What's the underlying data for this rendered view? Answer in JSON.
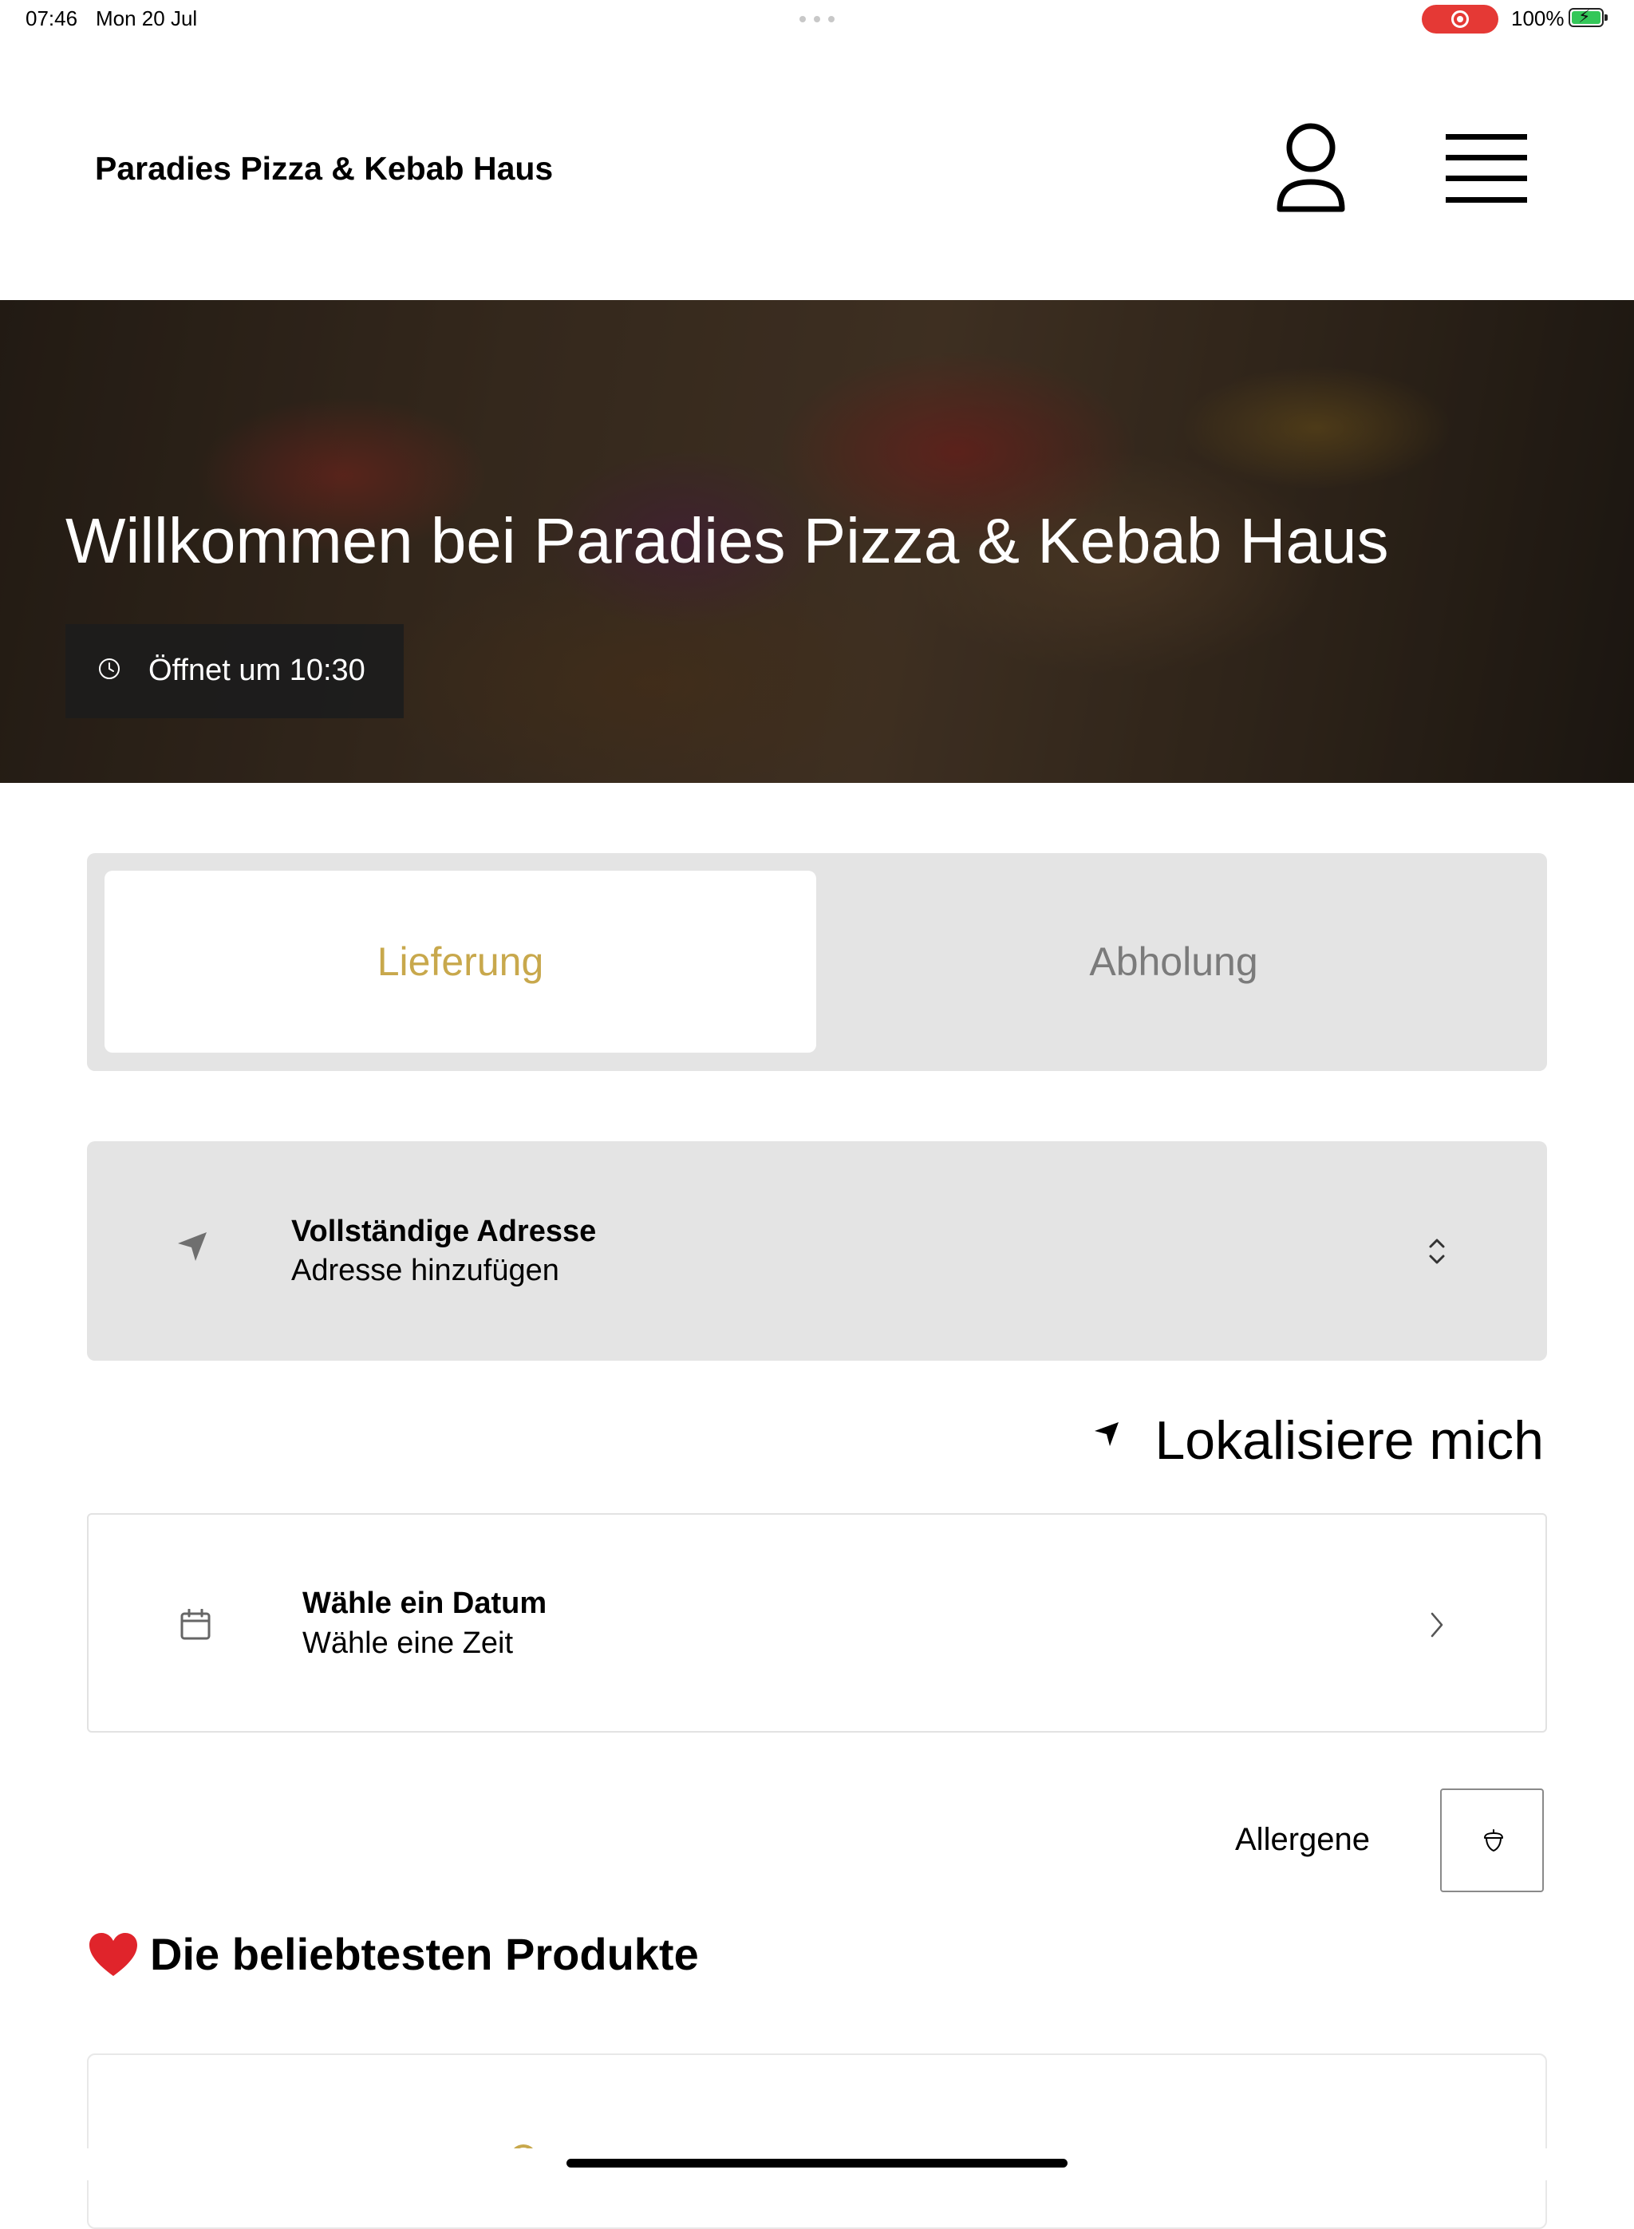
{
  "status_bar": {
    "time": "07:46",
    "date": "Mon 20 Jul",
    "battery": "100%",
    "recording_color": "#e53935",
    "battery_color": "#34c759"
  },
  "header": {
    "brand": "Paradies Pizza & Kebab Haus",
    "user_icon": "user-icon",
    "menu_icon": "hamburger-menu-icon"
  },
  "hero": {
    "title": "Willkommen bei Paradies Pizza & Kebab Haus",
    "hours_label": "Öffnet um 10:30",
    "hours_icon": "clock-icon"
  },
  "order_type": {
    "options": [
      "Lieferung",
      "Abholung"
    ],
    "selected": "Lieferung",
    "accent_color": "#c8a84c"
  },
  "address": {
    "title": "Vollständige Adresse",
    "subtitle": "Adresse hinzufügen",
    "icon": "navigation-arrow-icon"
  },
  "locate": {
    "label": "Lokalisiere mich",
    "icon": "location-arrow-icon"
  },
  "schedule": {
    "title": "Wähle ein Datum",
    "subtitle": "Wähle eine Zeit",
    "icon": "calendar-icon"
  },
  "allergens": {
    "label": "Allergene",
    "icon": "acorn-icon"
  },
  "popular": {
    "title": "Die beliebtesten Produkte",
    "icon": "heart-icon"
  }
}
